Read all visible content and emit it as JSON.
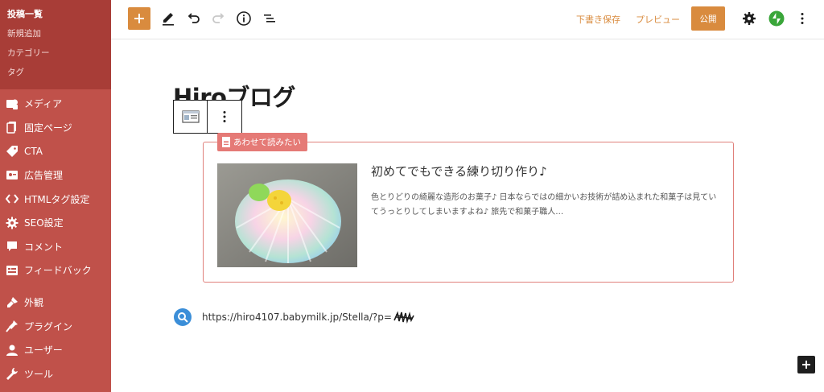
{
  "sidebar": {
    "submenu": [
      {
        "label": "投稿一覧",
        "current": true
      },
      {
        "label": "新規追加"
      },
      {
        "label": "カテゴリー"
      },
      {
        "label": "タグ"
      }
    ],
    "menu": [
      {
        "label": "メディア",
        "icon": "media-icon"
      },
      {
        "label": "固定ページ",
        "icon": "page-icon"
      },
      {
        "label": "CTA",
        "icon": "tag-icon"
      },
      {
        "label": "広告管理",
        "icon": "ad-icon"
      },
      {
        "label": "HTMLタグ設定",
        "icon": "code-icon"
      },
      {
        "label": "SEO設定",
        "icon": "gear-icon"
      },
      {
        "label": "コメント",
        "icon": "comment-icon"
      },
      {
        "label": "フィードバック",
        "icon": "feedback-icon"
      },
      {
        "label": "外観",
        "icon": "brush-icon"
      },
      {
        "label": "プラグイン",
        "icon": "plugin-icon"
      },
      {
        "label": "ユーザー",
        "icon": "user-icon"
      },
      {
        "label": "ツール",
        "icon": "wrench-icon"
      }
    ]
  },
  "toolbar": {
    "draft_label": "下書き保存",
    "preview_label": "プレビュー",
    "publish_label": "公開"
  },
  "editor": {
    "title": "Hiroブログ",
    "related": {
      "label": "あわせて読みたい",
      "title": "初めてでもできる練り切り作り♪",
      "excerpt": "色とりどりの綺麗な造形のお菓子♪ 日本ならではの細かいお技術が詰め込まれた和菓子は見ていてうっとりしてしまいますよね♪ 旅先で和菓子職人…"
    },
    "url": "https://hiro4107.babymilk.jp/Stella/?p="
  },
  "colors": {
    "sidebar": "#c0514a",
    "sidebar_submenu": "#a83d37",
    "accent": "#d98b3e",
    "related_border": "#e0807b",
    "related_label": "#e57a76"
  }
}
